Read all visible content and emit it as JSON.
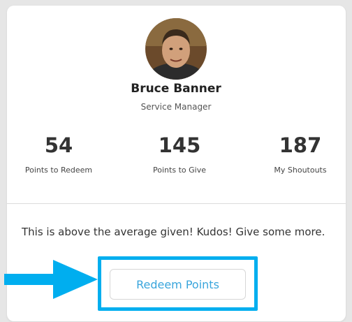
{
  "profile": {
    "name": "Bruce Banner",
    "title": "Service Manager"
  },
  "stats": [
    {
      "value": "54",
      "label": "Points to Redeem"
    },
    {
      "value": "145",
      "label": "Points to Give"
    },
    {
      "value": "187",
      "label": "My Shoutouts"
    }
  ],
  "message": "This is above the average given! Kudos! Give some more.",
  "redeem_button": {
    "label": "Redeem Points"
  },
  "colors": {
    "accent": "#39a5dc",
    "highlight": "#00aeef"
  }
}
